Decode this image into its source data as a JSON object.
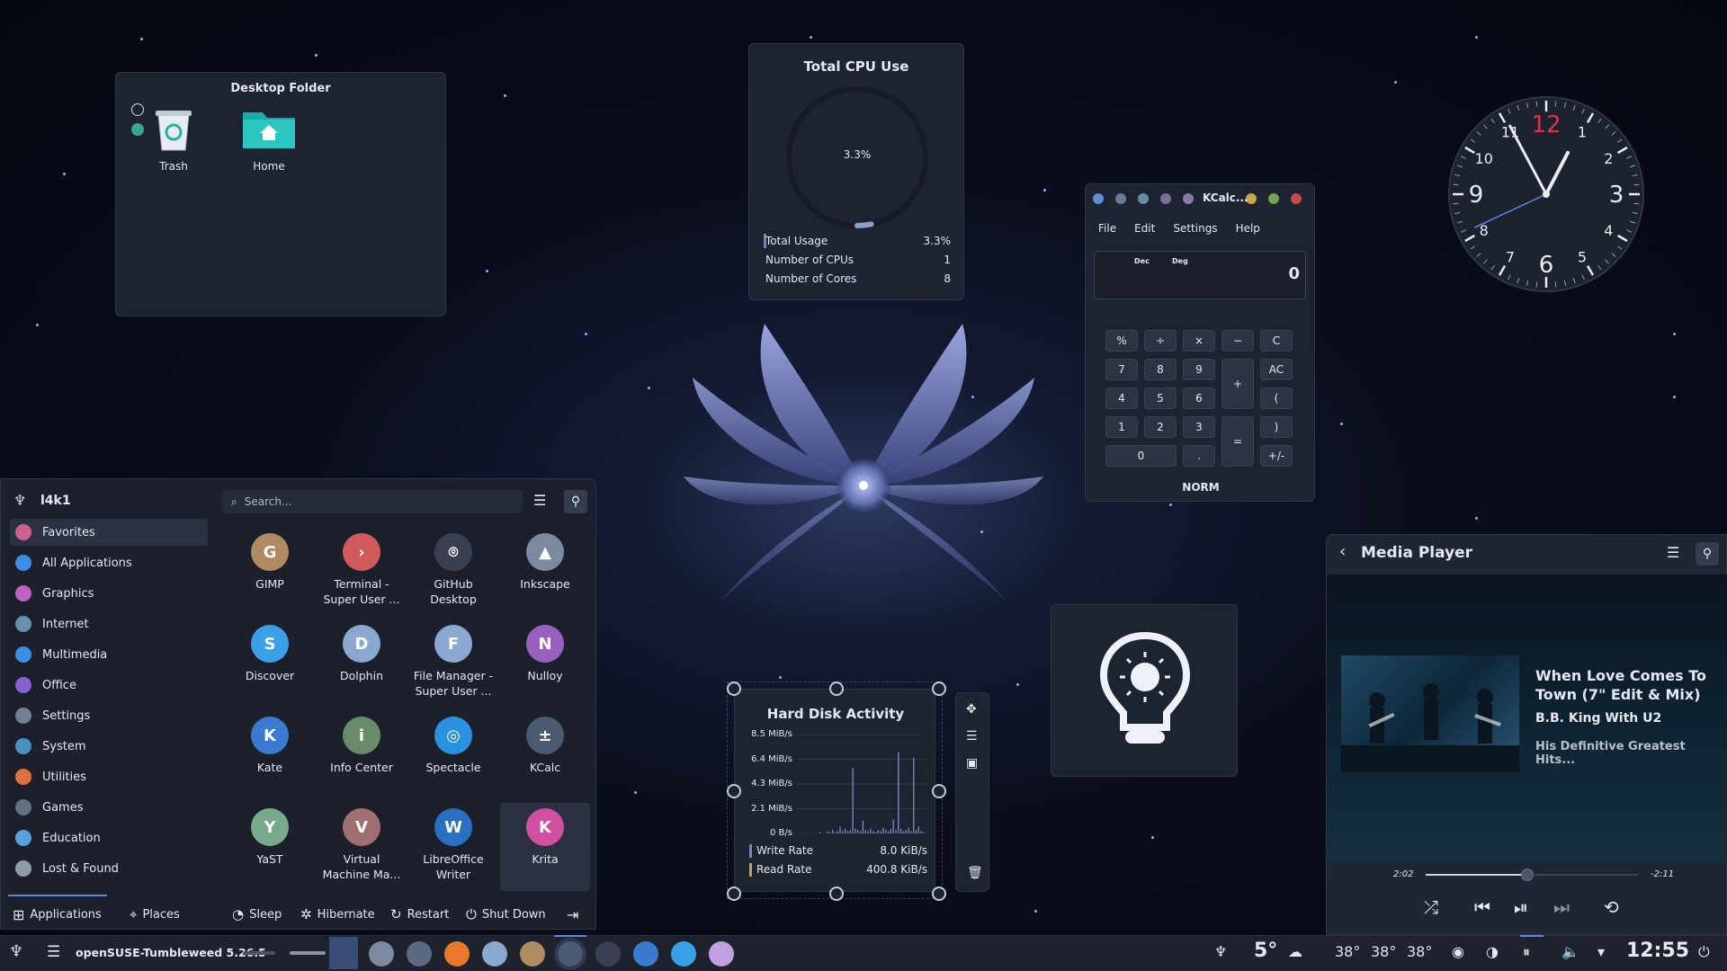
{
  "desktop_folder": {
    "title": "Desktop Folder",
    "items": [
      {
        "label": "Trash",
        "icon": "trash-icon"
      },
      {
        "label": "Home",
        "icon": "home-folder-icon"
      }
    ]
  },
  "cpu": {
    "title": "Total CPU Use",
    "percent_label": "3.3%",
    "usage_fraction": 0.033,
    "rows": [
      {
        "label": "Total Usage",
        "value": "3.3%"
      },
      {
        "label": "Number of CPUs",
        "value": "1"
      },
      {
        "label": "Number of Cores",
        "value": "8"
      }
    ]
  },
  "kcalc": {
    "title": "KCalc...",
    "menu": [
      "File",
      "Edit",
      "Settings",
      "Help"
    ],
    "mode_dec": "Dec",
    "mode_deg": "Deg",
    "display": "0",
    "status": "NORM",
    "keys": {
      "pct": "%",
      "div": "÷",
      "mul": "×",
      "sub": "−",
      "clear": "C",
      "k7": "7",
      "k8": "8",
      "k9": "9",
      "add": "+",
      "allclear": "AC",
      "k4": "4",
      "k5": "5",
      "k6": "6",
      "lparen": "(",
      "k1": "1",
      "k2": "2",
      "k3": "3",
      "eq": "=",
      "rparen": ")",
      "k0": "0",
      "dot": ".",
      "sign": "+/-"
    },
    "dot_colors": [
      "#5b8fd6",
      "#6c7a99",
      "#5f8fa0",
      "#7a6f9a",
      "#8a7aa8",
      "#c6a64a",
      "#78a050",
      "#c64a4a"
    ]
  },
  "clock": {
    "numbers": [
      "12",
      "1",
      "2",
      "3",
      "4",
      "5",
      "6",
      "7",
      "8",
      "9",
      "10",
      "11"
    ],
    "hour": 12,
    "minute": 55,
    "second": 20
  },
  "launcher": {
    "user": "l4k1",
    "search_placeholder": "Search...",
    "categories": [
      {
        "label": "Favorites",
        "color": "#d06090"
      },
      {
        "label": "All Applications",
        "color": "#3a8ee6"
      },
      {
        "label": "Graphics",
        "color": "#c060c0"
      },
      {
        "label": "Internet",
        "color": "#6a90b0"
      },
      {
        "label": "Multimedia",
        "color": "#3a8ee6"
      },
      {
        "label": "Office",
        "color": "#8a60d0"
      },
      {
        "label": "Settings",
        "color": "#708090"
      },
      {
        "label": "System",
        "color": "#4a90c0"
      },
      {
        "label": "Utilities",
        "color": "#e07040"
      },
      {
        "label": "Games",
        "color": "#607080"
      },
      {
        "label": "Education",
        "color": "#5aa0e0"
      },
      {
        "label": "Lost & Found",
        "color": "#909aa8"
      }
    ],
    "apps": [
      {
        "name": "GIMP",
        "color": "#b08a60",
        "glyph": "G"
      },
      {
        "name": "Terminal -\nSuper User ...",
        "color": "#d05a5a",
        "glyph": "›"
      },
      {
        "name": "GitHub\nDesktop",
        "color": "#3a4050",
        "glyph": "⌾"
      },
      {
        "name": "Inkscape",
        "color": "#7a8aa0",
        "glyph": "▲"
      },
      {
        "name": "Discover",
        "color": "#3aa0e8",
        "glyph": "S"
      },
      {
        "name": "Dolphin",
        "color": "#8aa8d0",
        "glyph": "D"
      },
      {
        "name": "File Manager -\nSuper User ...",
        "color": "#8aa8d0",
        "glyph": "F"
      },
      {
        "name": "Nulloy",
        "color": "#9a60c0",
        "glyph": "N"
      },
      {
        "name": "Kate",
        "color": "#3a7ad0",
        "glyph": "K"
      },
      {
        "name": "Info Center",
        "color": "#6a8a6a",
        "glyph": "i"
      },
      {
        "name": "Spectacle",
        "color": "#2a90e0",
        "glyph": "◎"
      },
      {
        "name": "KCalc",
        "color": "#4a5a70",
        "glyph": "±"
      },
      {
        "name": "YaST",
        "color": "#7aa88a",
        "glyph": "Y"
      },
      {
        "name": "Virtual\nMachine Ma...",
        "color": "#a07070",
        "glyph": "V"
      },
      {
        "name": "LibreOffice\nWriter",
        "color": "#2a70c0",
        "glyph": "W"
      },
      {
        "name": "Krita",
        "color": "#d050a0",
        "glyph": "K"
      }
    ],
    "footer": {
      "applications": "Applications",
      "places": "Places",
      "sleep": "Sleep",
      "hibernate": "Hibernate",
      "restart": "Restart",
      "shutdown": "Shut Down"
    }
  },
  "disk": {
    "title": "Hard Disk Activity",
    "yticks": [
      "8.5 MiB/s",
      "6.4 MiB/s",
      "4.3 MiB/s",
      "2.1 MiB/s",
      "0 B/s"
    ],
    "ymax": 8.5,
    "write_label": "Write Rate",
    "write_value": "8.0 KiB/s",
    "read_label": "Read Rate",
    "read_value": "400.8 KiB/s",
    "samples": [
      0,
      0,
      0,
      0,
      0,
      0,
      0,
      0,
      0.1,
      0,
      0,
      0.2,
      0.1,
      0.3,
      0.1,
      0.2,
      0.6,
      0.2,
      0.4,
      0.2,
      0.3,
      5.6,
      0.4,
      0.3,
      0.2,
      1.1,
      0.3,
      0.2,
      0.4,
      0.2,
      0.1,
      0.3,
      0.2,
      0.5,
      0.3,
      0.2,
      0.4,
      1.2,
      0.3,
      7.0,
      0.4,
      0.2,
      0.3,
      0.5,
      0.2,
      6.5,
      0.3,
      0.6,
      0.2,
      0.1
    ]
  },
  "media": {
    "title": "Media Player",
    "track": "When Love Comes To Town (7\" Edit & Mix)",
    "artist": "B.B. King With U2",
    "album": "His Definitive Greatest Hits...",
    "elapsed": "2:02",
    "remaining": "-2:11",
    "progress": 0.48
  },
  "taskbar": {
    "title": "openSUSE-Tumbleweed 5.26.5",
    "weather": "5°",
    "temps": [
      "38°",
      "38°",
      "38°"
    ],
    "clock": "12:55",
    "icon_colors": [
      "#7a8aa0",
      "#5a6a80",
      "#e8782a",
      "#8aa8d0",
      "#b08a60",
      "#4a5a70",
      "#3a4050",
      "#3a7ad0",
      "#3aa0e8",
      "#c0a0e0"
    ]
  }
}
